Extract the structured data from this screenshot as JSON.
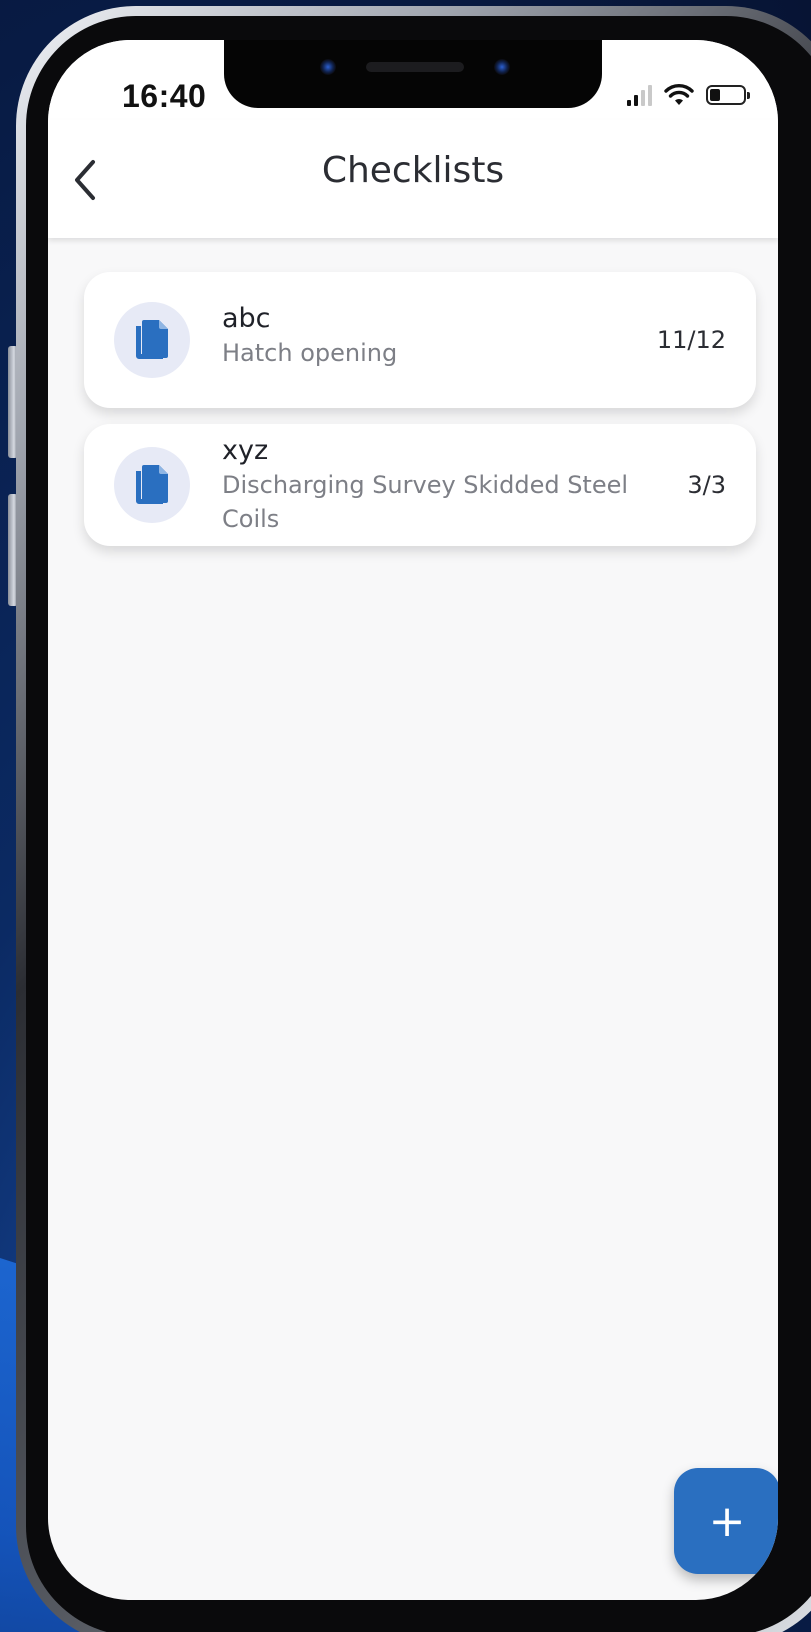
{
  "status_bar": {
    "time": "16:40",
    "signal_icon": "cellular-signal-icon",
    "wifi_icon": "wifi-icon",
    "battery_icon": "battery-icon",
    "battery_level": 0.3
  },
  "header": {
    "back_icon": "chevron-left-icon",
    "title": "Checklists"
  },
  "checklists": [
    {
      "name": "abc",
      "description": "Hatch opening",
      "progress": "11/12",
      "icon": "document-copy-icon"
    },
    {
      "name": "xyz",
      "description": "Discharging Survey Skidded Steel Coils",
      "progress": "3/3",
      "icon": "document-copy-icon"
    }
  ],
  "fab": {
    "label": "+",
    "icon": "plus-icon"
  },
  "colors": {
    "accent": "#2a6fc0",
    "icon_blue": "#2a6fc0",
    "avatar_bg": "#e7eaf6",
    "screen_bg": "#f8f8f9"
  }
}
